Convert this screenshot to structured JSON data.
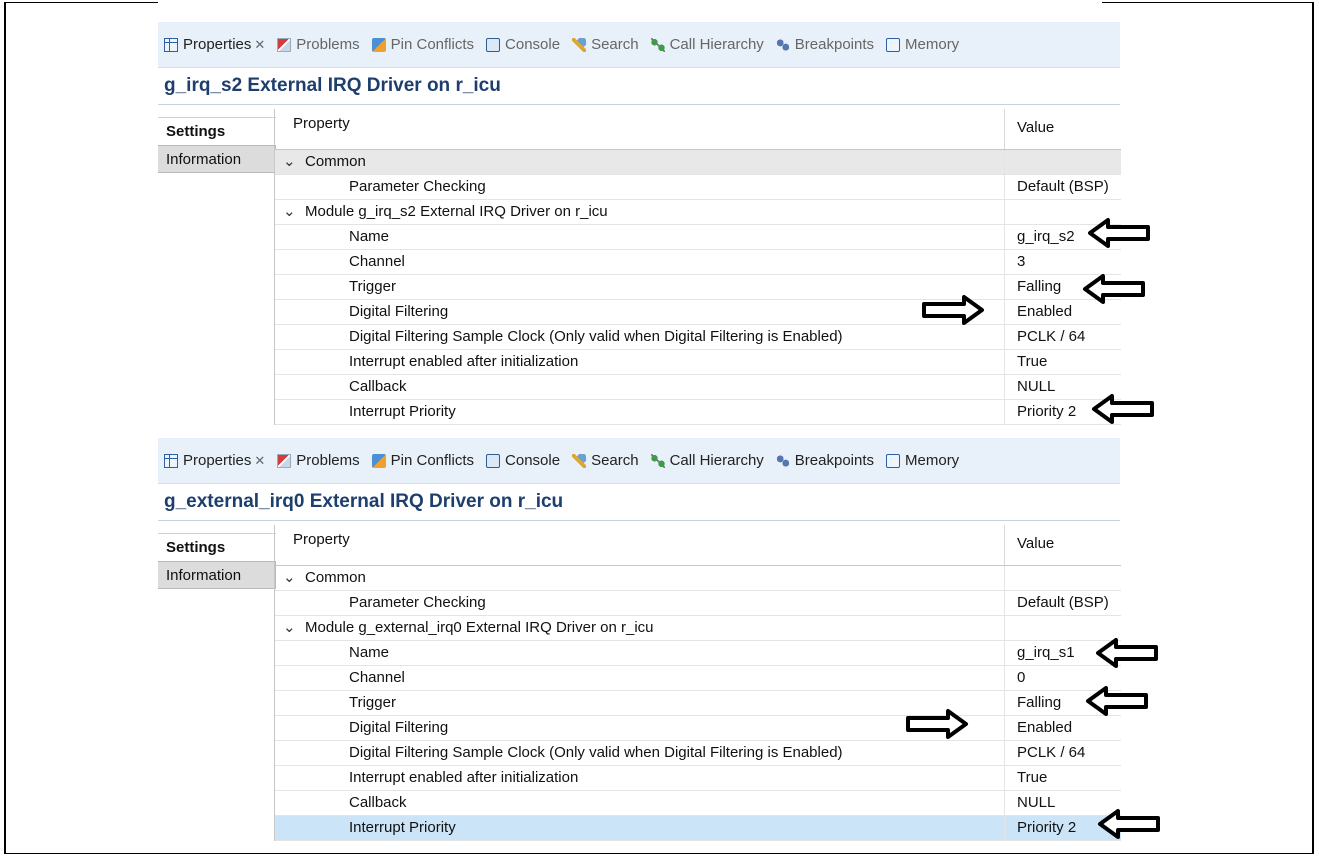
{
  "tabs": [
    {
      "label": "Properties",
      "icon": "properties-icon",
      "closable": true,
      "active": true
    },
    {
      "label": "Problems",
      "icon": "problems-icon"
    },
    {
      "label": "Pin Conflicts",
      "icon": "pin-conflicts-icon"
    },
    {
      "label": "Console",
      "icon": "console-icon"
    },
    {
      "label": "Search",
      "icon": "search-icon"
    },
    {
      "label": "Call Hierarchy",
      "icon": "call-hierarchy-icon"
    },
    {
      "label": "Breakpoints",
      "icon": "breakpoints-icon"
    },
    {
      "label": "Memory",
      "icon": "memory-icon"
    }
  ],
  "side_tabs": {
    "settings": "Settings",
    "information": "Information"
  },
  "columns": {
    "property": "Property",
    "value": "Value"
  },
  "panel1": {
    "title": "g_irq_s2 External IRQ Driver on r_icu",
    "rows": [
      {
        "label": "Common",
        "value": "",
        "group": true
      },
      {
        "label": "Parameter Checking",
        "value": "Default (BSP)"
      },
      {
        "label": "Module g_irq_s2 External IRQ Driver on r_icu",
        "value": "",
        "group": true
      },
      {
        "label": "Name",
        "value": "g_irq_s2"
      },
      {
        "label": "Channel",
        "value": "3"
      },
      {
        "label": "Trigger",
        "value": "Falling"
      },
      {
        "label": "Digital Filtering",
        "value": "Enabled"
      },
      {
        "label": "Digital Filtering Sample Clock (Only valid when Digital Filtering is Enabled)",
        "value": "PCLK / 64"
      },
      {
        "label": "Interrupt enabled after initialization",
        "value": "True"
      },
      {
        "label": "Callback",
        "value": "NULL"
      },
      {
        "label": "Interrupt Priority",
        "value": "Priority 2"
      }
    ]
  },
  "panel2": {
    "title": "g_external_irq0 External IRQ Driver on r_icu",
    "rows": [
      {
        "label": "Common",
        "value": "",
        "group": true
      },
      {
        "label": "Parameter Checking",
        "value": "Default (BSP)"
      },
      {
        "label": "Module g_external_irq0 External IRQ Driver on r_icu",
        "value": "",
        "group": true
      },
      {
        "label": "Name",
        "value": "g_irq_s1"
      },
      {
        "label": "Channel",
        "value": "0"
      },
      {
        "label": "Trigger",
        "value": "Falling"
      },
      {
        "label": "Digital Filtering",
        "value": "Enabled"
      },
      {
        "label": "Digital Filtering Sample Clock (Only valid when Digital Filtering is Enabled)",
        "value": "PCLK / 64"
      },
      {
        "label": "Interrupt enabled after initialization",
        "value": "True"
      },
      {
        "label": "Callback",
        "value": "NULL"
      },
      {
        "label": "Interrupt Priority",
        "value": "Priority 2",
        "selected": true
      }
    ]
  }
}
